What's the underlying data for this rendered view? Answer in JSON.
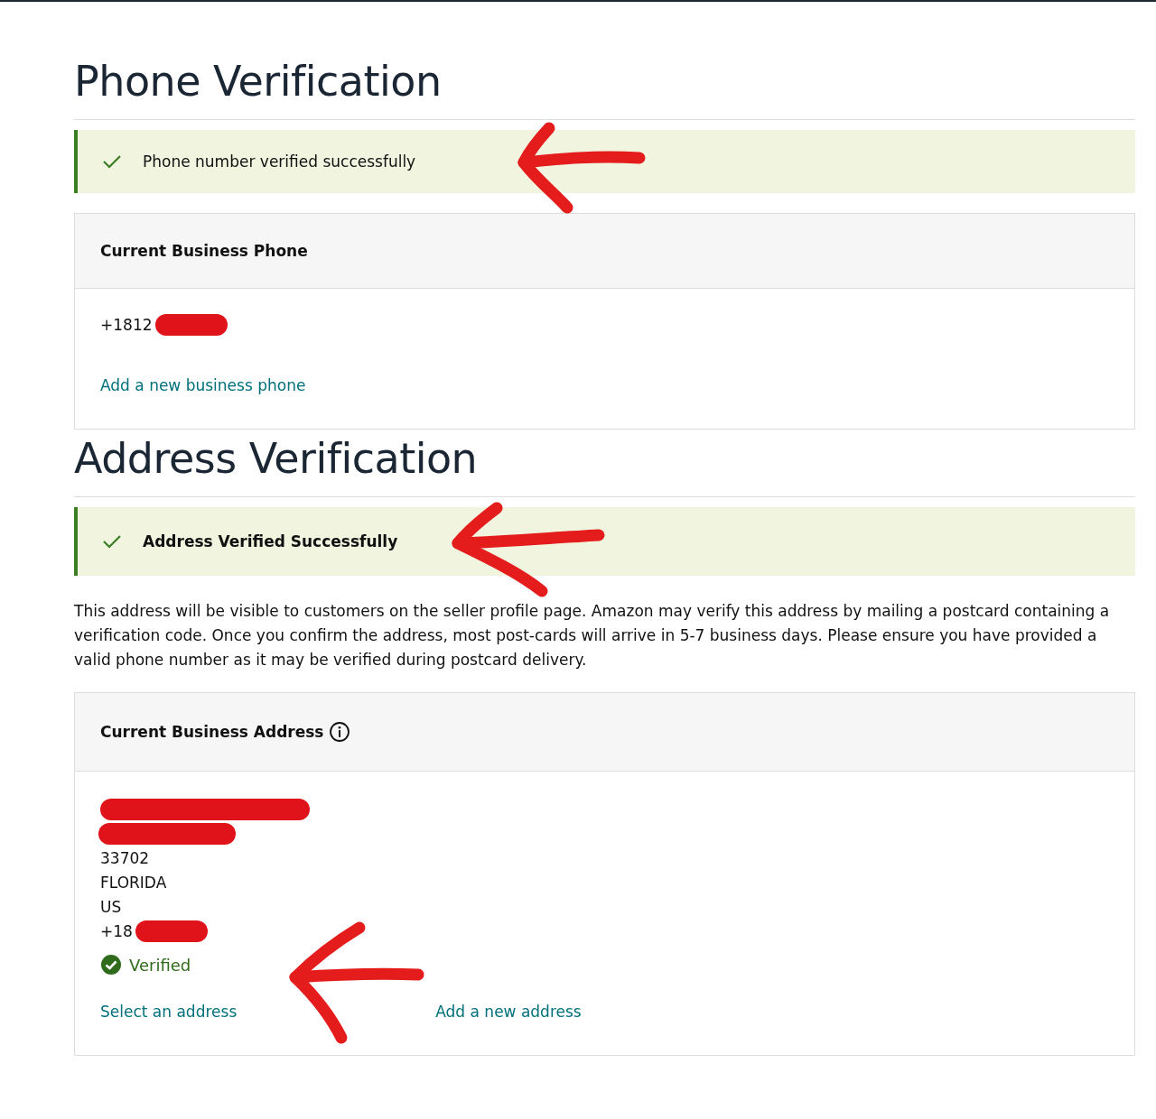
{
  "phone_section": {
    "title": "Phone Verification",
    "alert": {
      "text": "Phone number verified successfully",
      "bold": false
    },
    "card": {
      "header": "Current Business Phone",
      "phone": {
        "text": "+1812",
        "redacted_tail": true
      },
      "link": "Add a new business phone"
    }
  },
  "address_section": {
    "title": "Address Verification",
    "alert": {
      "text": "Address Verified Successfully",
      "bold": true
    },
    "notice": "This address will be visible to customers on the seller profile page. Amazon may verify this address by mailing a postcard containing a verification code. Once you confirm the address, most post-cards will arrive in 5-7 business days. Please ensure you have provided a valid phone number as it may be verified during postcard delivery.",
    "card": {
      "header": "Current Business Address",
      "info_icon": true,
      "lines": [
        {
          "kind": "redacted"
        },
        {
          "kind": "redacted"
        },
        {
          "kind": "text",
          "text": "33702",
          "redacted_tail": false
        },
        {
          "kind": "text",
          "text": "FLORIDA",
          "redacted_tail": false
        },
        {
          "kind": "text",
          "text": "US",
          "redacted_tail": false
        },
        {
          "kind": "text",
          "text": "+18",
          "redacted_tail": true
        }
      ],
      "status": {
        "text": "Verified",
        "verified": true
      },
      "links": [
        "Select an address",
        "Add a new address"
      ]
    }
  }
}
